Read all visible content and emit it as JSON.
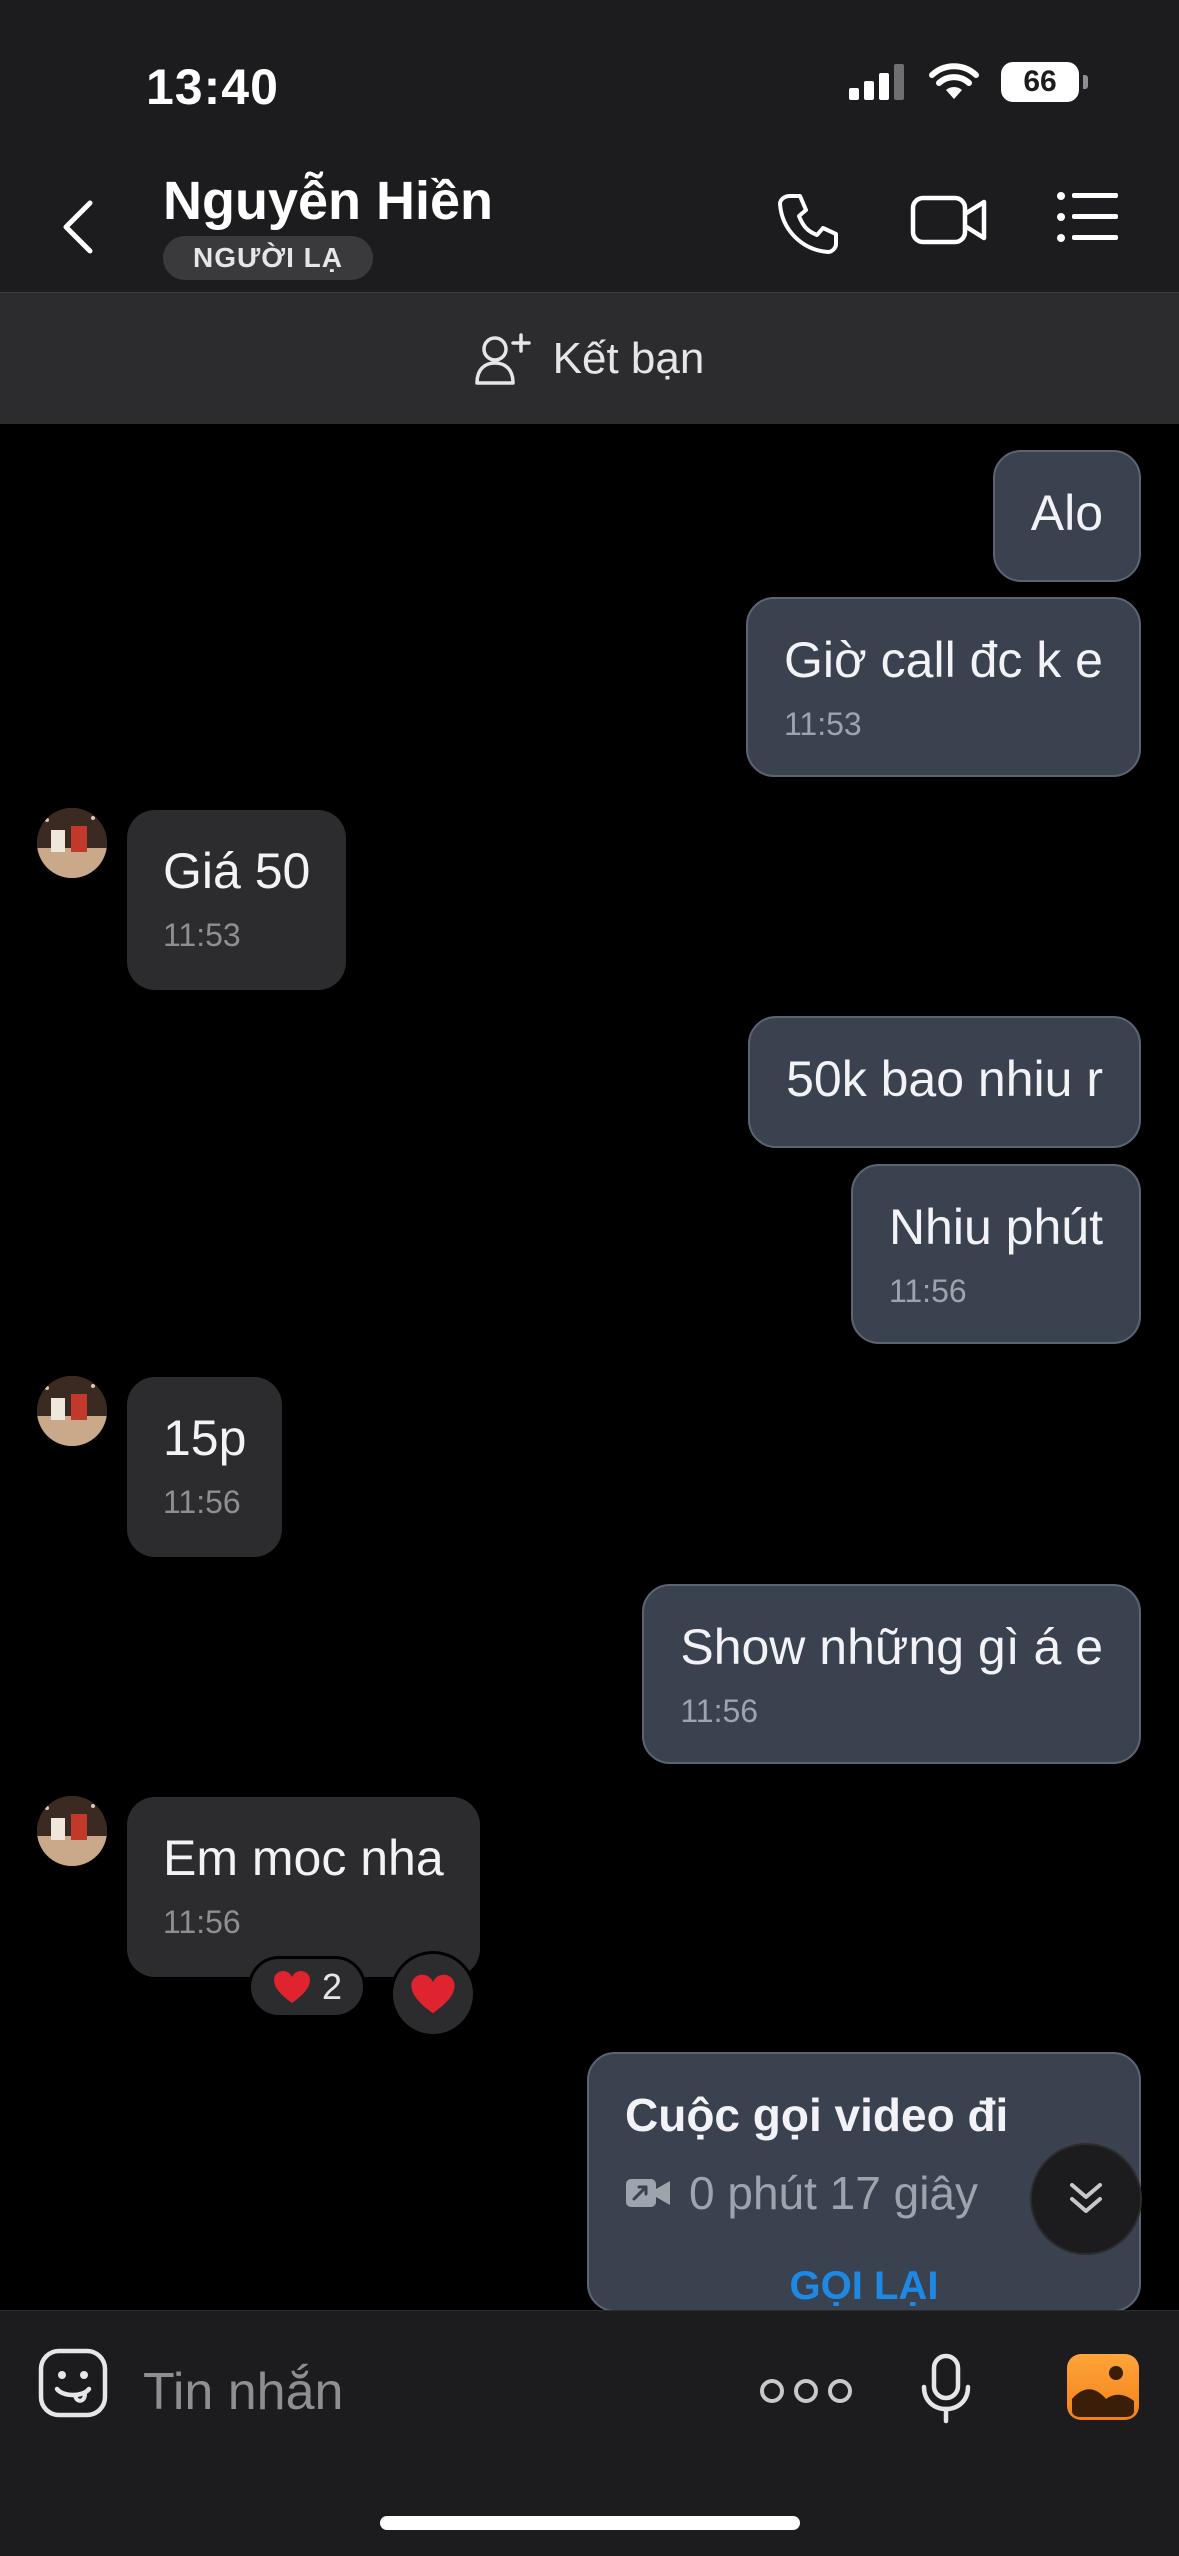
{
  "status_bar": {
    "time": "13:40",
    "battery": "66"
  },
  "header": {
    "contact_name": "Nguyễn Hiền",
    "badge": "NGƯỜI LẠ",
    "icons": [
      "back-icon",
      "phone-icon",
      "video-camera-icon",
      "menu-list-icon"
    ]
  },
  "friend_bar": {
    "label": "Kết bạn",
    "icon": "add-person-icon"
  },
  "messages": [
    {
      "dir": "out",
      "text": "Alo",
      "time": ""
    },
    {
      "dir": "out",
      "text": "Giờ call đc k e",
      "time": "11:53"
    },
    {
      "dir": "in",
      "text": "Giá 50",
      "time": "11:53"
    },
    {
      "dir": "out",
      "text": "50k bao nhiu r",
      "time": ""
    },
    {
      "dir": "out",
      "text": "Nhiu phút",
      "time": "11:56"
    },
    {
      "dir": "in",
      "text": "15p",
      "time": "11:56"
    },
    {
      "dir": "out",
      "text": "Show những gì á e",
      "time": "11:56"
    },
    {
      "dir": "in",
      "text": "Em moc nha",
      "time": "11:56"
    }
  ],
  "reactions": {
    "count": "2",
    "emoji": "❤️"
  },
  "call_card": {
    "title": "Cuộc gọi video đi",
    "duration": "0 phút 17 giây",
    "action": "GỌI LẠI"
  },
  "composer": {
    "placeholder": "Tin nhắn"
  }
}
